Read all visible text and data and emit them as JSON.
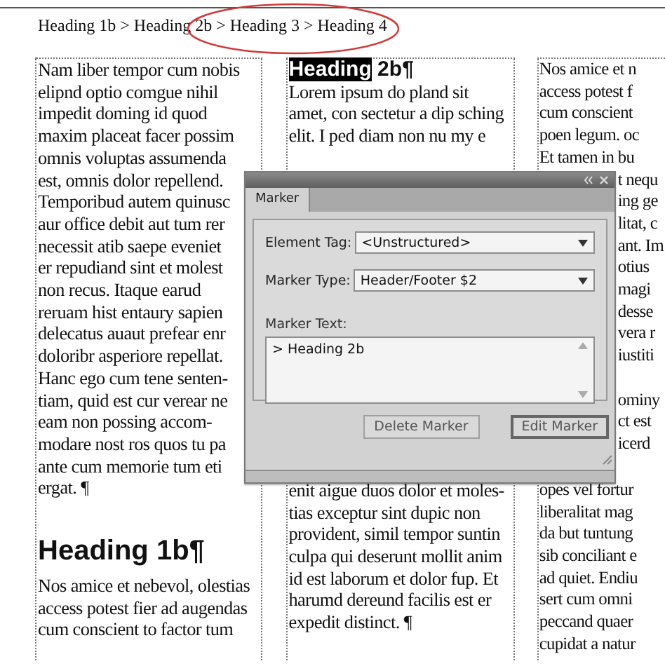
{
  "breadcrumb": "Heading 1b > Heading 2b > Heading 3 > Heading 4",
  "columns": [
    {
      "blocks": [
        {
          "kind": "paragraph",
          "lines": [
            "Nam liber tempor cum nobis",
            "elipnd optio comgue nihil",
            "impedit doming id quod",
            "maxim placeat facer possim",
            "omnis voluptas assumenda",
            "est, omnis dolor repellend.",
            "Temporibud autem quinusc",
            "aur office debit aut tum rer",
            "necessit atib saepe eveniet",
            "er repudiand sint et molest",
            "non recus. Itaque earud",
            "reruam hist entaury sapien",
            "delecatus auaut prefear enr",
            "doloribr asperiore repellat.",
            "Hanc ego cum tene senten-",
            "tiam, quid est cur verear ne",
            "eam non possing accom-",
            "modare nost ros quos tu pa",
            "ante cum memorie tum eti",
            "ergat. ¶"
          ]
        },
        {
          "kind": "heading",
          "text": "Heading 1b¶"
        },
        {
          "kind": "paragraph",
          "lines": [
            "Nos amice et nebevol, olestias",
            "access potest fier ad augendas",
            "cum conscient to factor tum"
          ]
        }
      ]
    },
    {
      "blocks": [
        {
          "kind": "subheading",
          "selected_part": "Heading",
          "text": " 2b¶"
        },
        {
          "kind": "paragraph",
          "lines": [
            "Lorem ipsum do pland sit",
            "amet, con sectetur a dip sching",
            "elit. I ped diam non nu my e"
          ]
        },
        {
          "kind": "paragraph",
          "lines": [
            "enit aigue duos dolor et moles-",
            "tias exceptur sint dupic non",
            "provident, simil tempor suntin",
            "culpa qui deserunt mollit anim",
            "id est laborum et dolor fup. Et",
            "harumd dereund facilis est er",
            "expedit distinct. ¶"
          ]
        }
      ]
    },
    {
      "blocks": [
        {
          "kind": "paragraph",
          "lines": [
            "Nos amice et n",
            "access potest f",
            "cum conscient",
            "poen legum. oc",
            "Et tamen in bu"
          ]
        },
        {
          "kind": "beside_dialog",
          "lines": [
            "t nequ",
            "ing ge",
            "litat, c",
            "ant. Im",
            "otius",
            "magi",
            "desse",
            "vera r",
            "iustiti"
          ]
        },
        {
          "kind": "beside_dialog",
          "lines": [
            "ominy",
            "ct est",
            "icerd"
          ]
        },
        {
          "kind": "paragraph",
          "lines": [
            "opes vel fortur",
            "liberalitat mag",
            "da but tuntung",
            "sib conciliant e",
            "ad quiet. Endiu",
            "sert cum omni",
            "peccand quaer",
            "cupidat a natur"
          ]
        }
      ]
    }
  ],
  "dialog": {
    "tab": {
      "label": "Marker",
      "selected": true
    },
    "fields": [
      {
        "label": "Element Tag:",
        "value": "<Unstructured>"
      },
      {
        "label": "Marker Type:",
        "value": "Header/Footer $2"
      }
    ],
    "text_label": "Marker Text:",
    "text_value": "> Heading 2b",
    "buttons": [
      {
        "label": "Delete Marker",
        "default": false
      },
      {
        "label": "Edit Marker",
        "default": true
      }
    ]
  }
}
